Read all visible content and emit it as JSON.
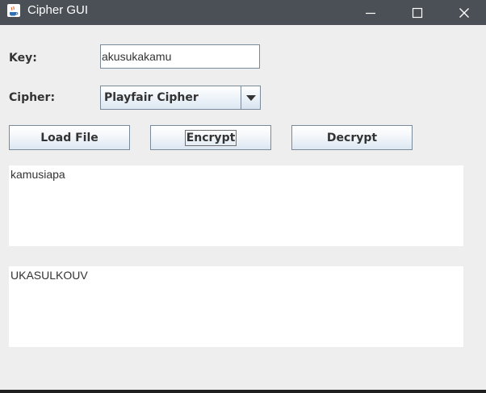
{
  "window": {
    "title": "Cipher GUI",
    "icons": {
      "app": "java-coffee-cup-icon",
      "minimize": "minimize-icon",
      "maximize": "maximize-icon",
      "close": "close-icon"
    }
  },
  "form": {
    "key_label": "Key:",
    "key_value": "akusukakamu",
    "cipher_label": "Cipher:",
    "cipher_selected": "Playfair Cipher",
    "cipher_dropdown_icon": "dropdown-arrow-icon"
  },
  "actions": {
    "load_file": "Load File",
    "encrypt": "Encrypt",
    "decrypt": "Decrypt"
  },
  "text": {
    "input": "kamusiapa",
    "output": "UKASULKOUV"
  },
  "colors": {
    "titlebar": "#4b5056",
    "window_bg": "#eeeeee",
    "text_area_bg": "#ffffff",
    "button_border": "#7a8a99",
    "button_gradient_bottom": "#dce7f2"
  }
}
